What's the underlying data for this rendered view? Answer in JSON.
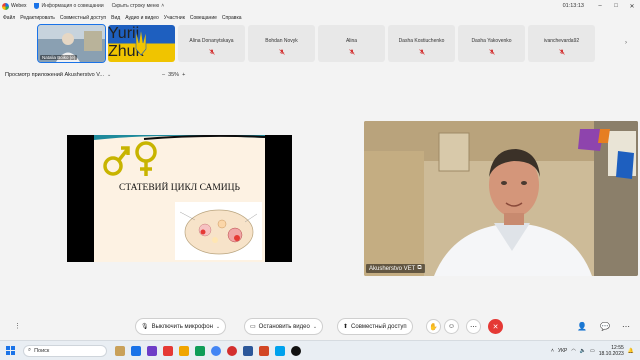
{
  "window": {
    "app_name": "Webex",
    "meeting_info": "Информация о совещании",
    "hide_menu": "Скрыть строку меню",
    "timer": "01:13:13"
  },
  "menu": {
    "items": [
      "Файл",
      "Редактировать",
      "Совместный доступ",
      "Вид",
      "Аудио и видео",
      "Участник",
      "Совещание",
      "Справка"
    ]
  },
  "participants": [
    {
      "name": "Natalia Boiko (e)",
      "type": "video"
    },
    {
      "name": "Yurii Zhuk",
      "type": "flag"
    },
    {
      "name": "Alina Donanytskaya",
      "type": "name"
    },
    {
      "name": "Bohdan Novyk",
      "type": "name"
    },
    {
      "name": "Alina",
      "type": "name"
    },
    {
      "name": "Dasha Kostiuchenko",
      "type": "name"
    },
    {
      "name": "Dasha Yakovenko",
      "type": "name"
    },
    {
      "name": "ivanchevarda92",
      "type": "name"
    }
  ],
  "share": {
    "title": "Просмотр приложений Akusherstvo V...",
    "zoom": "35%"
  },
  "slide": {
    "title": "СТАТЕВИЙ ЦИКЛ САМИЦЬ"
  },
  "video": {
    "name": "Akusherstvo VET"
  },
  "controls": {
    "mute": "Выключить микрофон",
    "video": "Остановить видео",
    "share": "Совместный доступ"
  },
  "taskbar": {
    "search": "Поиск",
    "lang": "УКР",
    "time": "12:55",
    "date": "18.10.2023"
  },
  "colors": {
    "accent": "#1a73e8",
    "end_call": "#e53935",
    "mute_icon": "#d32f2f"
  }
}
